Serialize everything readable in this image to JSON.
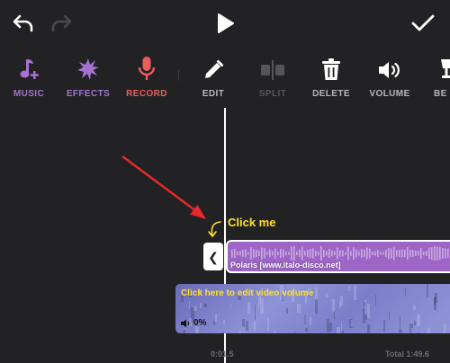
{
  "colors": {
    "background": "#222224",
    "accent_purple": "#a573cf",
    "record_red": "#ea5d5d",
    "disabled": "#555558",
    "annotation_yellow": "#ffe02a",
    "annotation_arrow": "#e8272e",
    "audio_clip": "#9d66c6",
    "video_clip": "#7b7fc9"
  },
  "topbar": {
    "undo_icon": "undo-icon",
    "redo_icon": "redo-icon",
    "play_icon": "play-icon",
    "done_icon": "checkmark-icon"
  },
  "toolbar": {
    "tools": [
      {
        "id": "music",
        "label": "MUSIC",
        "icon": "music-note-plus-icon"
      },
      {
        "id": "effects",
        "label": "EFFECTS",
        "icon": "sparkle-burst-icon"
      },
      {
        "id": "record",
        "label": "RECORD",
        "icon": "microphone-icon"
      },
      {
        "id": "edit",
        "label": "EDIT",
        "icon": "pencil-icon"
      },
      {
        "id": "split",
        "label": "SPLIT",
        "icon": "split-icon"
      },
      {
        "id": "delete",
        "label": "DELETE",
        "icon": "trash-icon"
      },
      {
        "id": "volume",
        "label": "VOLUME",
        "icon": "speaker-icon"
      },
      {
        "id": "beat",
        "label": "BE",
        "icon": "beat-icon"
      }
    ]
  },
  "annotation": {
    "callout": "Click me"
  },
  "timeline": {
    "trim_handle_glyph": "❮",
    "audio_clip": {
      "name": "Polaris [www.italo-disco.net]"
    },
    "video_clip": {
      "label": "Click here to edit video volume",
      "volume": "0%"
    },
    "current_time": "0:01.5",
    "total_time": "Total 1:49.6"
  }
}
